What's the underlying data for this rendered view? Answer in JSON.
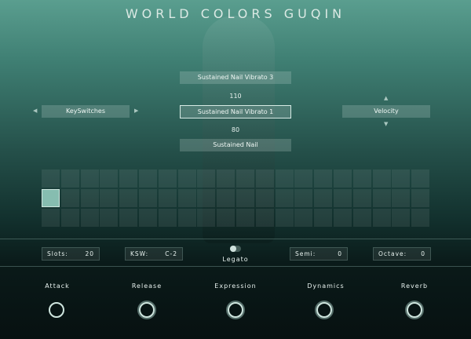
{
  "title": "WORLD COLORS GUQIN",
  "articulations": {
    "top": "Sustained Nail Vibrato 3",
    "top_value": "110",
    "selected": "Sustained Nail Vibrato 1",
    "bottom_value": "80",
    "bottom": "Sustained Nail"
  },
  "left_selector": {
    "label": "KeySwitches"
  },
  "right_selector": {
    "label": "Velocity"
  },
  "arrows": {
    "left": "◀",
    "right": "▶",
    "up": "▲",
    "down": "▼"
  },
  "grid": {
    "rows": 3,
    "cols": 20,
    "active_row": 1,
    "active_col": 0
  },
  "stats": {
    "slots_label": "Slots:",
    "slots_value": "20",
    "ksw_label": "KSW:",
    "ksw_value": "C-2",
    "semi_label": "Semi:",
    "semi_value": "0",
    "octave_label": "Octave:",
    "octave_value": "0"
  },
  "legato": {
    "label": "Legato",
    "on": false
  },
  "knobs": [
    {
      "label": "Attack"
    },
    {
      "label": "Release"
    },
    {
      "label": "Expression"
    },
    {
      "label": "Dynamics"
    },
    {
      "label": "Reverb"
    }
  ],
  "colors": {
    "accent": "#86bdb0",
    "bg_top": "#5a9e8f",
    "bg_bottom": "#071111"
  }
}
